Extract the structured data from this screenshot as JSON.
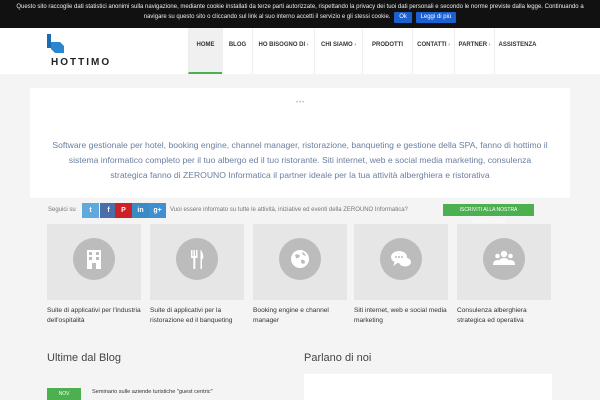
{
  "cookie": {
    "text": "Questo sito raccoglie dati statistici anonimi sulla navigazione, mediante cookie installati da terze parti autorizzate, rispettando la privacy dei tuoi dati personali e secondo le norme previste dalla legge. Continuando a navigare su questo sito o cliccando sul link al suo interno accetti il servizio e gli stessi cookie.",
    "ok_label": "Ok",
    "more_label": "Leggi di più"
  },
  "brand": {
    "name": "HOTTIMO",
    "color": "#1b6db3"
  },
  "nav": [
    {
      "label": "HOME",
      "active": true
    },
    {
      "label": "BLOG"
    },
    {
      "label": "HO BISOGNO DI",
      "caret": "›"
    },
    {
      "label": "CHI SIAMO",
      "caret": "›"
    },
    {
      "label": "PRODOTTI"
    },
    {
      "label": "CONTATTI",
      "caret": "›"
    },
    {
      "label": "PARTNER",
      "caret": "›"
    },
    {
      "label": "ASSISTENZA"
    }
  ],
  "hero": {
    "dots": "•••",
    "text": "Software gestionale per hotel, booking engine, channel manager, ristorazione, banqueting e gestione della SPA, fanno di hottimo il sistema informatico completo per il tuo albergo ed il tuo ristorante. Siti internet, web e social media marketing, consulenza strategica fanno di ZEROUNO Informatica il partner ideale per la tua attività alberghiera e ristorativa"
  },
  "social": {
    "label": "Seguici su",
    "buttons": [
      {
        "glyph": "t",
        "icon": "twitter-icon",
        "color": "#5fa9dd"
      },
      {
        "glyph": "f",
        "icon": "facebook-icon",
        "color": "#4a6ea9"
      },
      {
        "glyph": "P",
        "icon": "pinterest-icon",
        "color": "#cc2127"
      },
      {
        "glyph": "in",
        "icon": "linkedin-icon",
        "color": "#3a8ac4"
      },
      {
        "glyph": "g+",
        "icon": "google-plus-icon",
        "color": "#3f8fd1"
      }
    ],
    "question": "Vuoi essere informato su tutte le attività, iniziative ed eventi della ZEROUNO Informatica?",
    "newsletter_label": "ISCRIVITI ALLA NOSTRA NEWSLETTER"
  },
  "services": [
    {
      "icon": "building-icon",
      "label": "Suite di applicativi per l'industria dell'ospitalità"
    },
    {
      "icon": "fork-knife-icon",
      "label": "Suite di applicativi per la ristorazione ed il banqueting"
    },
    {
      "icon": "globe-icon",
      "label": "Booking engine e channel manager"
    },
    {
      "icon": "chat-bubbles-icon",
      "label": "Siti internet, web e social media marketing"
    },
    {
      "icon": "people-icon",
      "label": "Consulenza alberghiera strategica ed operativa"
    }
  ],
  "blog": {
    "title": "Ultime dal Blog",
    "first_post": "Seminario sulle aziende turistiche \"guest centric\"",
    "date_badge": "NOV"
  },
  "press": {
    "title": "Parlano di noi"
  },
  "colors": {
    "accent": "#4caf50",
    "link": "#6b7fa0",
    "cookie_bg": "#111111"
  }
}
